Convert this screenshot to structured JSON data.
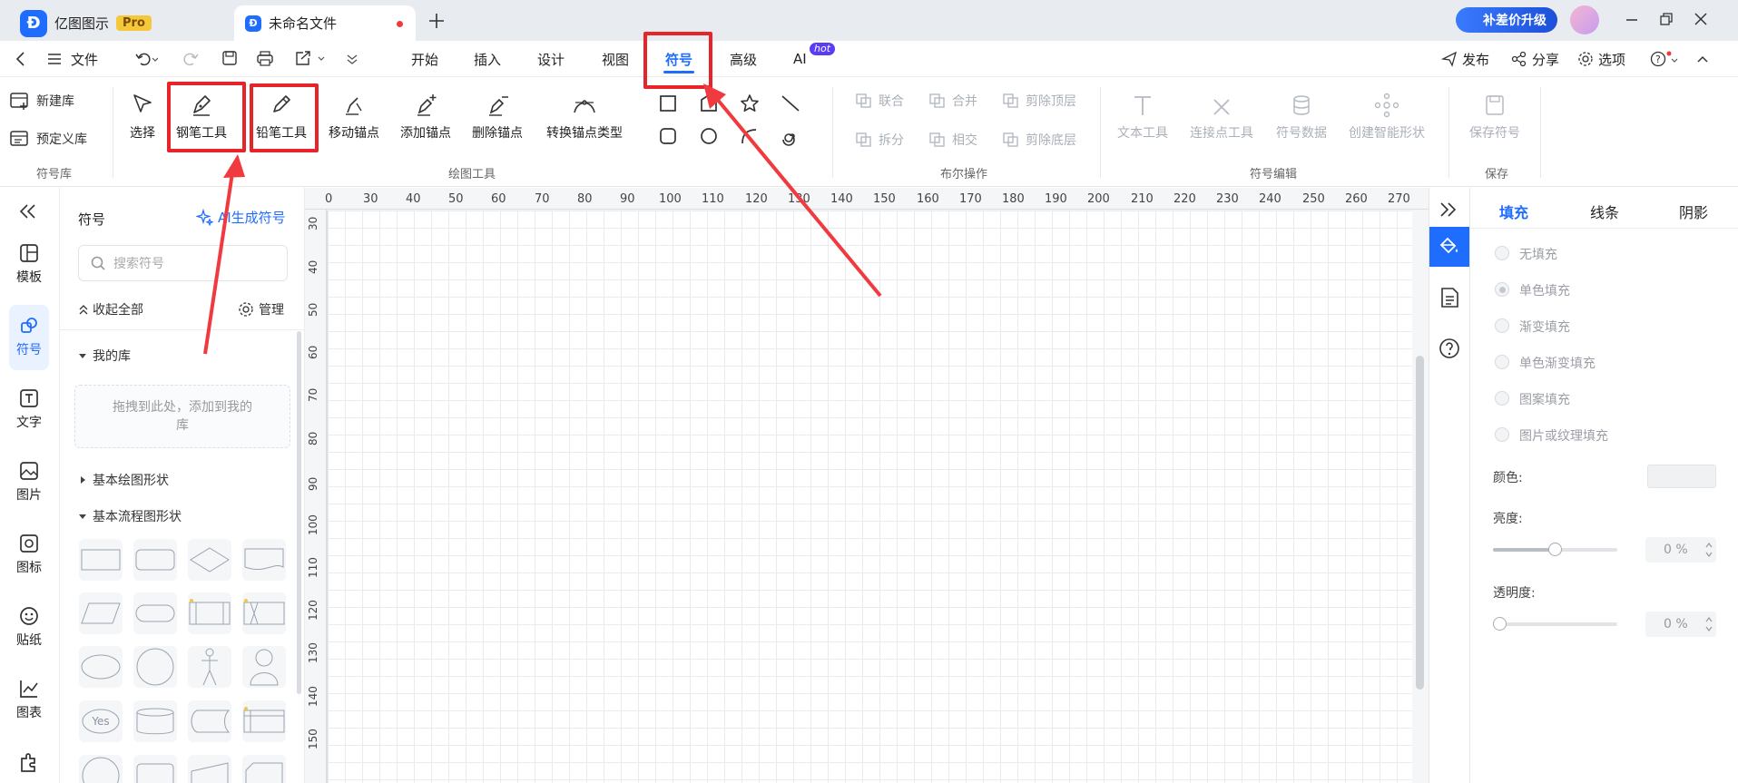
{
  "tabs": {
    "app_name": "亿图图示",
    "pro_badge": "Pro",
    "doc_tab": "未命名文件",
    "upgrade_label": "补差价升级"
  },
  "menubar": {
    "file": "文件",
    "items": [
      "开始",
      "插入",
      "设计",
      "视图",
      "符号",
      "高级",
      "AI"
    ],
    "active": "符号",
    "ai_badge": "hot",
    "publish": "发布",
    "share": "分享",
    "options": "选项"
  },
  "ribbon": {
    "new_lib": "新建库",
    "predefined_lib": "预定义库",
    "group_symbol_lib": "符号库",
    "select": "选择",
    "pen_tool": "钢笔工具",
    "pencil_tool": "铅笔工具",
    "move_anchor": "移动锚点",
    "add_anchor": "添加锚点",
    "delete_anchor": "删除锚点",
    "convert_anchor": "转换锚点类型",
    "group_draw_tools": "绘图工具",
    "union": "联合",
    "combine": "合并",
    "subtract_top": "剪除顶层",
    "split": "拆分",
    "intersect": "相交",
    "subtract_bottom": "剪除底层",
    "group_boolean": "布尔操作",
    "text_tool": "文本工具",
    "connect_tool": "连接点工具",
    "symbol_data": "符号数据",
    "smart_shape": "创建智能形状",
    "group_symbol_edit": "符号编辑",
    "save_symbol": "保存符号",
    "group_save": "保存"
  },
  "leftnav": [
    "模板",
    "符号",
    "文字",
    "图片",
    "图标",
    "贴纸",
    "图表"
  ],
  "symbol_panel": {
    "title": "符号",
    "ai_generate": "AI生成符号",
    "search_placeholder": "搜索符号",
    "collapse_all": "收起全部",
    "manage": "管理",
    "my_lib": "我的库",
    "drop_hint": "拖拽到此处，添加到我的库",
    "basic_drawing": "基本绘图形状",
    "basic_flow": "基本流程图形状",
    "yes_shape": "Yes"
  },
  "ruler": {
    "h": [
      "0",
      "30",
      "40",
      "50",
      "60",
      "70",
      "80",
      "90",
      "100",
      "110",
      "120",
      "130",
      "140",
      "150",
      "160",
      "170",
      "180",
      "190",
      "200",
      "210",
      "220",
      "230",
      "240",
      "250",
      "260",
      "270"
    ],
    "v": [
      "30",
      "40",
      "50",
      "60",
      "70",
      "80",
      "90",
      "100",
      "110",
      "120",
      "130",
      "140",
      "150"
    ]
  },
  "right_panel": {
    "tabs": [
      "填充",
      "线条",
      "阴影"
    ],
    "active_tab": "填充",
    "fill_options": [
      "无填充",
      "单色填充",
      "渐变填充",
      "单色渐变填充",
      "图案填充",
      "图片或纹理填充"
    ],
    "color_label": "颜色:",
    "brightness_label": "亮度:",
    "brightness_value": "0 %",
    "transparency_label": "透明度:",
    "transparency_value": "0 %"
  },
  "colors": {
    "accent": "#1f6dff",
    "highlight": "#e8242b"
  }
}
